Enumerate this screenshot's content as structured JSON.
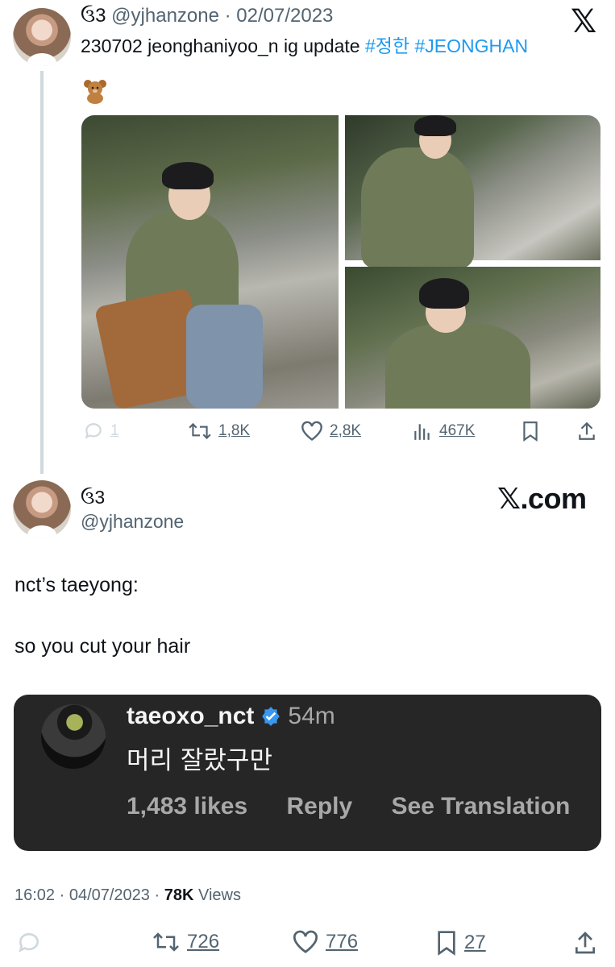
{
  "tweet": {
    "symbol": "ઉ3",
    "handle": "@yjhanzone",
    "date": "· 02/07/2023",
    "text": "230702 jeonghaniyoo_n ig update ",
    "hashtags": [
      "#정한",
      "#JEONGHAN"
    ],
    "emoji": "teddy-bear",
    "stats": {
      "replies": "1",
      "retweets": "1,8K",
      "likes": "2,8K",
      "views": "467K"
    }
  },
  "logo": {
    "x": "𝕏",
    "xcom": "𝕏.com"
  },
  "quote": {
    "symbol": "ઉ3",
    "handle": "@yjhanzone",
    "line1": "nct’s taeyong:",
    "line2": "so you cut your hair"
  },
  "ig": {
    "username": "taeoxo_nct",
    "time": "54m",
    "comment": "머리 잘랐구만",
    "likes": "1,483 likes",
    "reply": "Reply",
    "translate": "See Translation"
  },
  "footer": {
    "time_date": "16:02 · 04/07/2023 · ",
    "views_count": "78K",
    "views_label": " Views",
    "retweets": "726",
    "likes": "776",
    "bookmarks": "27"
  },
  "colors": {
    "accent": "#1d9bf0",
    "muted": "#536471",
    "card": "#262626"
  }
}
